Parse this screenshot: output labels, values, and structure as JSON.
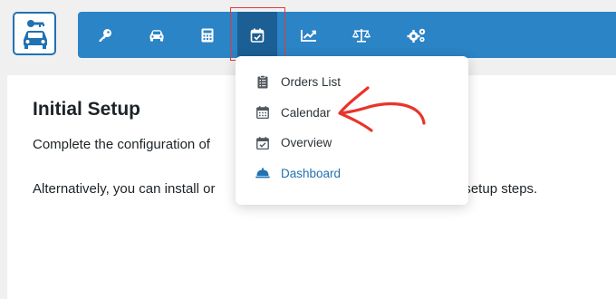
{
  "colors": {
    "toolbar": "#2b84c6",
    "toolbar_active": "#1b5f94",
    "highlight": "#e53935",
    "accent": "#2271b1",
    "annotation_arrow": "#e8352b"
  },
  "logo": {
    "icon": "car-key-logo-icon"
  },
  "toolbar": {
    "items": [
      {
        "icon": "key-icon",
        "active": false
      },
      {
        "icon": "car-icon",
        "active": false
      },
      {
        "icon": "calculator-icon",
        "active": false
      },
      {
        "icon": "calendar-check-icon",
        "active": true
      },
      {
        "icon": "chart-line-icon",
        "active": false
      },
      {
        "icon": "balance-scale-icon",
        "active": false
      },
      {
        "icon": "cogs-icon",
        "active": false
      }
    ]
  },
  "dropdown": {
    "items": [
      {
        "label": "Orders List",
        "icon": "clipboard-list-icon"
      },
      {
        "label": "Calendar",
        "icon": "calendar-icon"
      },
      {
        "label": "Overview",
        "icon": "calendar-check-icon"
      },
      {
        "label": "Dashboard",
        "icon": "concierge-bell-icon",
        "accent": true
      }
    ]
  },
  "content": {
    "heading": "Initial Setup",
    "paragraph1": "Complete the configuration of",
    "paragraph2_start": "Alternatively, you can install or",
    "paragraph2_end": "e initial setup steps."
  },
  "annotation": {
    "type": "red-arrow",
    "points_to": "Calendar"
  }
}
